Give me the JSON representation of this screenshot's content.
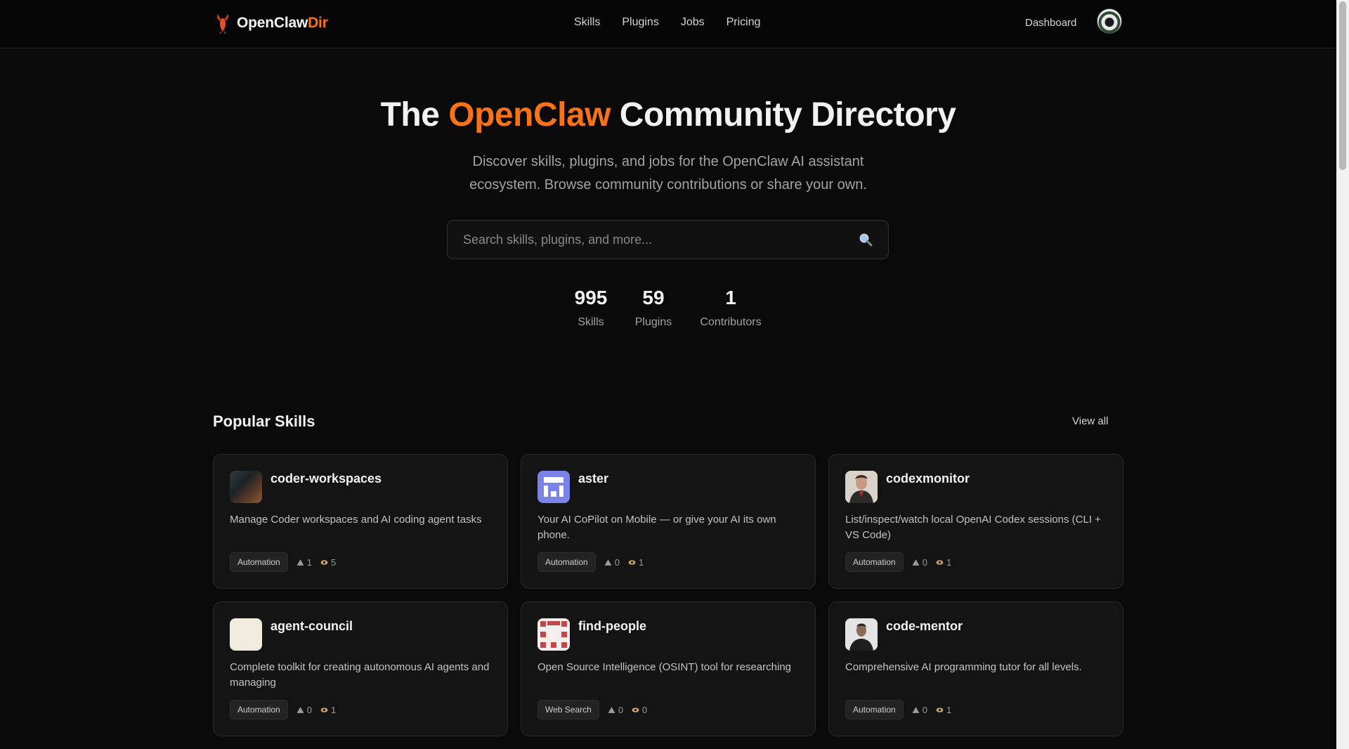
{
  "brand": {
    "name_main": "OpenClaw",
    "name_accent": "Dir",
    "accent_color": "#f97316"
  },
  "nav": {
    "links": [
      "Skills",
      "Plugins",
      "Jobs",
      "Pricing"
    ],
    "dashboard": "Dashboard"
  },
  "hero": {
    "title_before": "The ",
    "title_accent": "OpenClaw",
    "title_after": " Community Directory",
    "subtitle": "Discover skills, plugins, and jobs for the OpenClaw AI assistant ecosystem. Browse community contributions or share your own."
  },
  "search": {
    "placeholder": "Search skills, plugins, and more..."
  },
  "stats": [
    {
      "value": "995",
      "label": "Skills"
    },
    {
      "value": "59",
      "label": "Plugins"
    },
    {
      "value": "1",
      "label": "Contributors"
    }
  ],
  "popular": {
    "title": "Popular Skills",
    "view_all": "View all",
    "cards": [
      {
        "name": "coder-workspaces",
        "description": "Manage Coder workspaces and AI coding agent tasks",
        "tag": "Automation",
        "upvotes": "1",
        "views": "5",
        "avatar": "photo-dark-icon"
      },
      {
        "name": "aster",
        "description": "Your AI CoPilot on Mobile — or give your AI its own phone.",
        "tag": "Automation",
        "upvotes": "0",
        "views": "1",
        "avatar": "purple-identicon"
      },
      {
        "name": "codexmonitor",
        "description": "List/inspect/watch local OpenAI Codex sessions (CLI + VS Code)",
        "tag": "Automation",
        "upvotes": "0",
        "views": "1",
        "avatar": "portrait-photo-icon"
      },
      {
        "name": "agent-council",
        "description": "Complete toolkit for creating autonomous AI agents and managing",
        "tag": "Automation",
        "upvotes": "0",
        "views": "1",
        "avatar": "blank-cream-icon"
      },
      {
        "name": "find-people",
        "description": "Open Source Intelligence (OSINT) tool for researching",
        "tag": "Web Search",
        "upvotes": "0",
        "views": "0",
        "avatar": "red-identicon"
      },
      {
        "name": "code-mentor",
        "description": "Comprehensive AI programming tutor for all levels.",
        "tag": "Automation",
        "upvotes": "0",
        "views": "1",
        "avatar": "person-photo-icon"
      }
    ]
  }
}
